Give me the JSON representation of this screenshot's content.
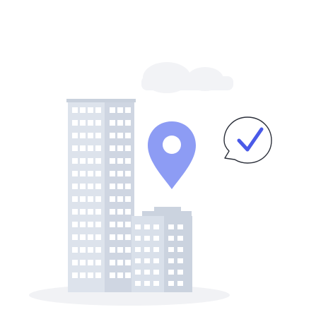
{
  "illustration": {
    "subject": "office-buildings-with-location-pin-and-checkmark",
    "icons": [
      "cloud-icon",
      "location-pin-icon",
      "checkmark-bubble-icon"
    ],
    "colors": {
      "background": "#ffffff",
      "cloud": "#f2f3f6",
      "ground_shadow": "#f1f2f5",
      "tower_front": "#dde3ec",
      "tower_side": "#cfd6e2",
      "window": "#ffffff",
      "low_building": "#d9e0ea",
      "low_building_roof": "#cbd3df",
      "pin": "#8d9cf4",
      "pin_hole": "#ffffff",
      "check": "#4a5ae8",
      "bubble_outline": "#2b2f3a"
    }
  }
}
